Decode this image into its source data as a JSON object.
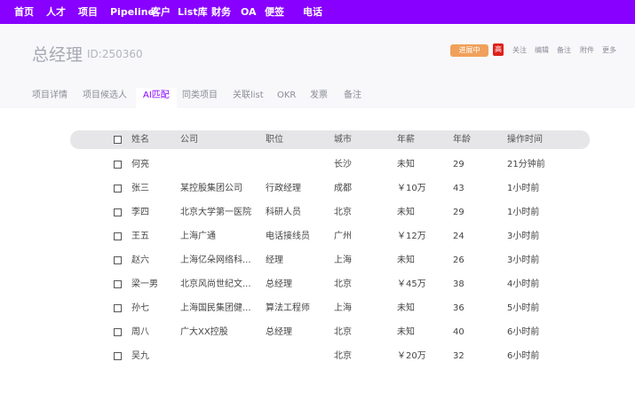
{
  "nav": {
    "items": [
      "首页",
      "人才",
      "项目",
      "Pipeline",
      "客户",
      "List库",
      "财务",
      "OA",
      "便签",
      "电话"
    ]
  },
  "project": {
    "title": "总经理",
    "id_label": "ID:250360",
    "status_badge": "进展中",
    "priority_badge": "高",
    "actions": [
      "关注",
      "编辑",
      "备注",
      "附件",
      "更多"
    ]
  },
  "tabs": {
    "items": [
      "项目详情",
      "项目候选人",
      "AI匹配",
      "同类项目",
      "关联list",
      "OKR",
      "发票",
      "备注"
    ],
    "active": "AI匹配"
  },
  "table": {
    "headers": [
      "姓名",
      "公司",
      "职位",
      "城市",
      "年薪",
      "年龄",
      "操作时间"
    ],
    "rows": [
      [
        "何亮",
        "",
        "",
        "长沙",
        "未知",
        "29",
        "21分钟前"
      ],
      [
        "张三",
        "某控股集团公司",
        "行政经理",
        "成都",
        "￥10万",
        "43",
        "1小时前"
      ],
      [
        "李四",
        "北京大学第一医院",
        "科研人员",
        "北京",
        "未知",
        "29",
        "1小时前"
      ],
      [
        "王五",
        "上海广通",
        "电话接线员",
        "广州",
        "￥12万",
        "24",
        "3小时前"
      ],
      [
        "赵六",
        "上海亿朵网络科...",
        "经理",
        "上海",
        "未知",
        "26",
        "3小时前"
      ],
      [
        "梁一男",
        "北京风尚世纪文...",
        "总经理",
        "北京",
        "￥45万",
        "38",
        "4小时前"
      ],
      [
        "孙七",
        "上海国民集团健...",
        "算法工程师",
        "上海",
        "未知",
        "36",
        "5小时前"
      ],
      [
        "周八",
        "广大XX控股",
        "总经理",
        "北京",
        "未知",
        "40",
        "6小时前"
      ],
      [
        "吴九",
        "",
        "",
        "北京",
        "￥20万",
        "32",
        "6小时前"
      ]
    ]
  },
  "colors": {
    "nav_bg": "#8800ff",
    "active_tab": "#8800ff",
    "status_badge": "#f0a05a",
    "priority_badge": "#e0201a"
  }
}
